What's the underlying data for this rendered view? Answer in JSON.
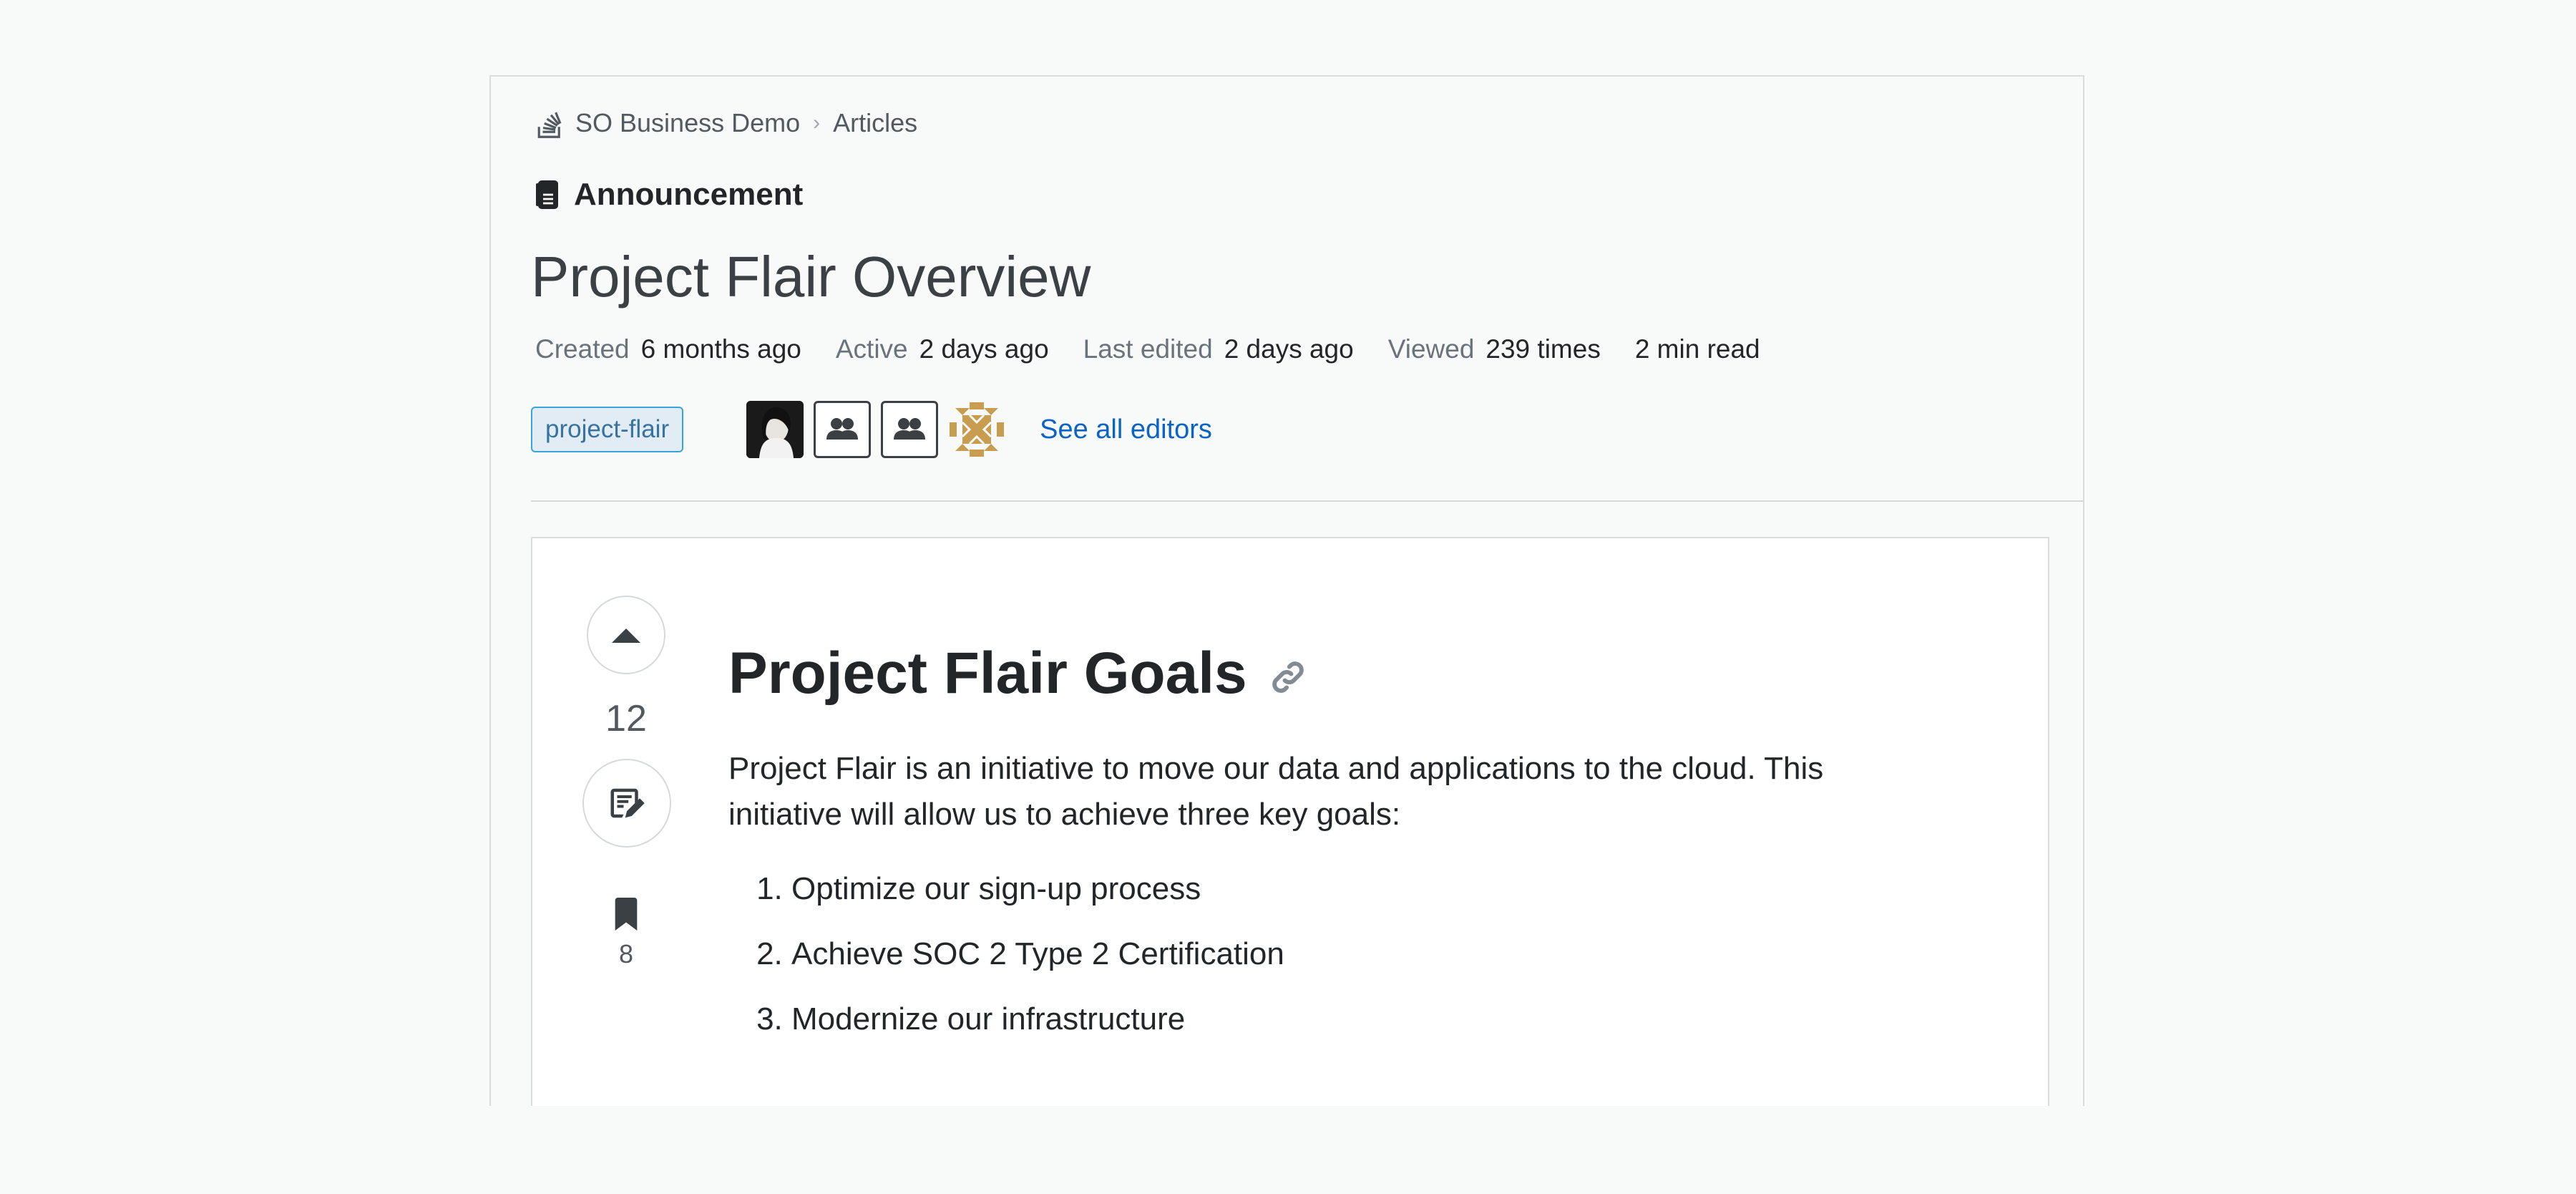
{
  "breadcrumb": {
    "site": "SO Business Demo",
    "section": "Articles"
  },
  "article": {
    "type_label": "Announcement",
    "title": "Project Flair Overview",
    "meta": [
      {
        "key": "Created",
        "value": "6 months ago"
      },
      {
        "key": "Active",
        "value": "2 days ago"
      },
      {
        "key": "Last edited",
        "value": "2 days ago"
      },
      {
        "key": "Viewed",
        "value": "239 times"
      }
    ],
    "read_time": "2 min read",
    "tag": "project-flair",
    "see_editors": "See all editors"
  },
  "sidebar": {
    "vote_count": "12",
    "bookmark_count": "8"
  },
  "content": {
    "heading": "Project Flair Goals",
    "intro": "Project Flair is an initiative to move our data and applications to the cloud. This initiative will allow us to achieve three key goals:",
    "goals": [
      "Optimize our sign-up process",
      "Achieve SOC 2 Type 2 Certification",
      "Modernize our infrastructure"
    ]
  },
  "colors": {
    "link": "#0a63c6",
    "tag_border": "#39a4db",
    "background": "#f8f9f9"
  },
  "icons": [
    "stackoverflow-icon",
    "document-icon",
    "chevron-right-icon",
    "upvote-icon",
    "edit-icon",
    "bookmark-icon",
    "link-icon",
    "group-icon"
  ]
}
